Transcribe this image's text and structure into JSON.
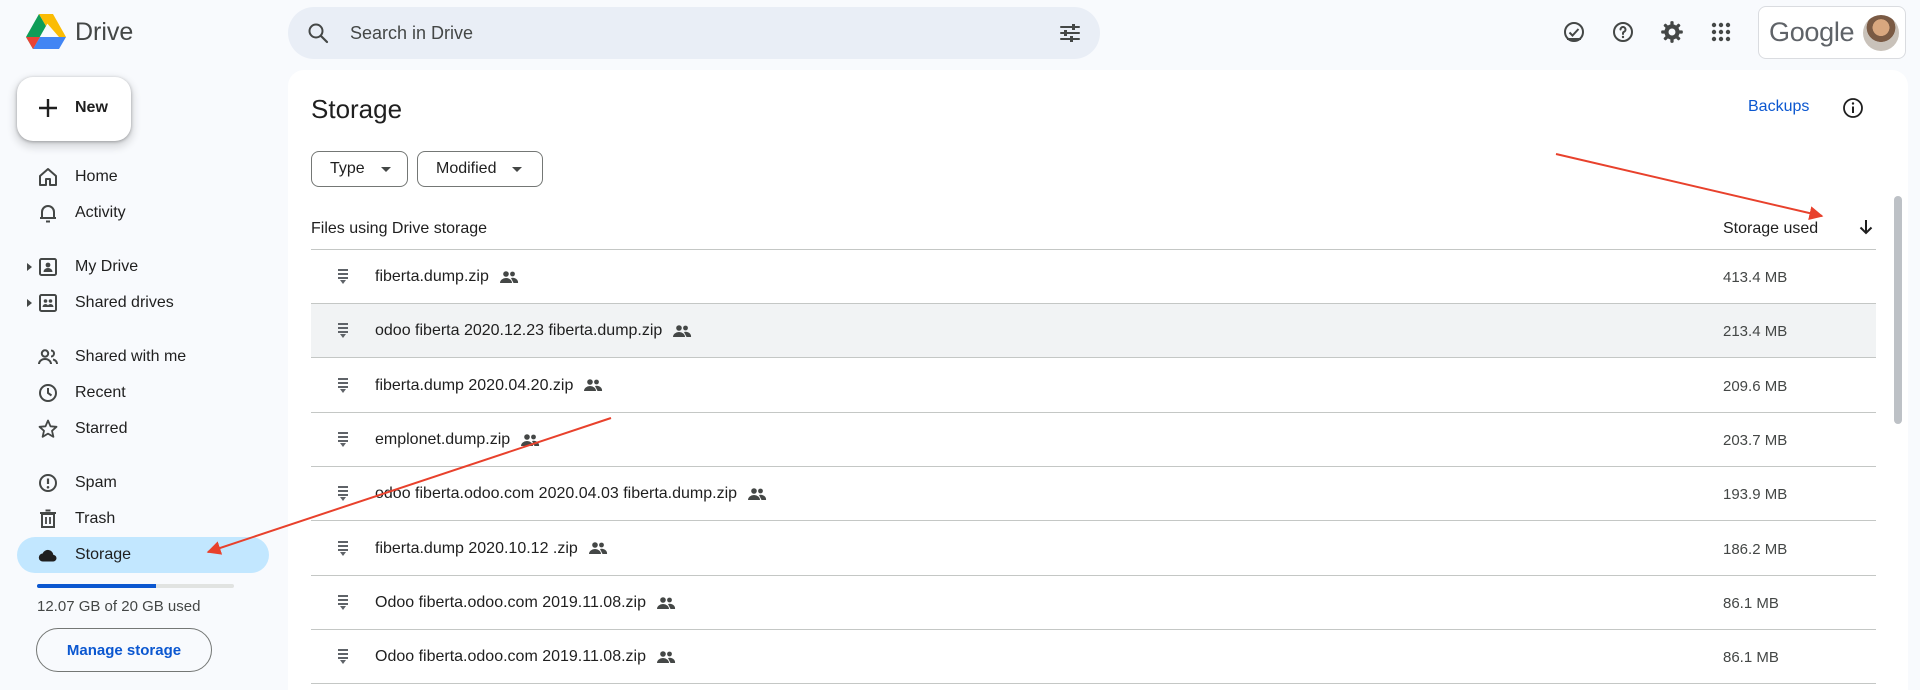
{
  "app": {
    "name": "Drive"
  },
  "search": {
    "placeholder": "Search in Drive"
  },
  "header_icons": [
    "offline-ready-icon",
    "help-icon",
    "settings-icon",
    "apps-grid-icon"
  ],
  "account": {
    "brand": "Google"
  },
  "sidebar": {
    "new_label": "New",
    "items": [
      {
        "label": "Home",
        "icon": "home-icon"
      },
      {
        "label": "Activity",
        "icon": "bell-icon"
      },
      {
        "label": "My Drive",
        "icon": "my-drive-icon"
      },
      {
        "label": "Shared drives",
        "icon": "shared-drives-icon"
      },
      {
        "label": "Shared with me",
        "icon": "people-icon"
      },
      {
        "label": "Recent",
        "icon": "clock-icon"
      },
      {
        "label": "Starred",
        "icon": "star-icon"
      },
      {
        "label": "Spam",
        "icon": "spam-icon"
      },
      {
        "label": "Trash",
        "icon": "trash-icon"
      },
      {
        "label": "Storage",
        "icon": "cloud-icon",
        "active": true
      }
    ],
    "storage": {
      "text": "12.07 GB of 20 GB used",
      "used_fraction": 0.6035
    },
    "manage_label": "Manage storage"
  },
  "main": {
    "title": "Storage",
    "backups_label": "Backups",
    "filters": [
      "Type",
      "Modified"
    ],
    "columns": {
      "name": "Files using Drive storage",
      "size": "Storage used"
    },
    "files": [
      {
        "name": "fiberta.dump.zip",
        "size": "413.4 MB"
      },
      {
        "name": "odoo fiberta 2020.12.23 fiberta.dump.zip",
        "size": "213.4 MB"
      },
      {
        "name": "fiberta.dump 2020.04.20.zip",
        "size": "209.6 MB"
      },
      {
        "name": "emplonet.dump.zip",
        "size": "203.7 MB"
      },
      {
        "name": "odoo fiberta.odoo.com 2020.04.03 fiberta.dump.zip",
        "size": "193.9 MB"
      },
      {
        "name": "fiberta.dump 2020.10.12 .zip",
        "size": "186.2 MB"
      },
      {
        "name": "Odoo fiberta.odoo.com 2019.11.08.zip",
        "size": "86.1 MB"
      },
      {
        "name": "Odoo fiberta.odoo.com 2019.11.08.zip",
        "size": "86.1 MB"
      }
    ]
  },
  "colors": {
    "accent": "#0b57d0",
    "active_nav": "#c2e7ff",
    "annotation_arrow": "#e8412c"
  }
}
